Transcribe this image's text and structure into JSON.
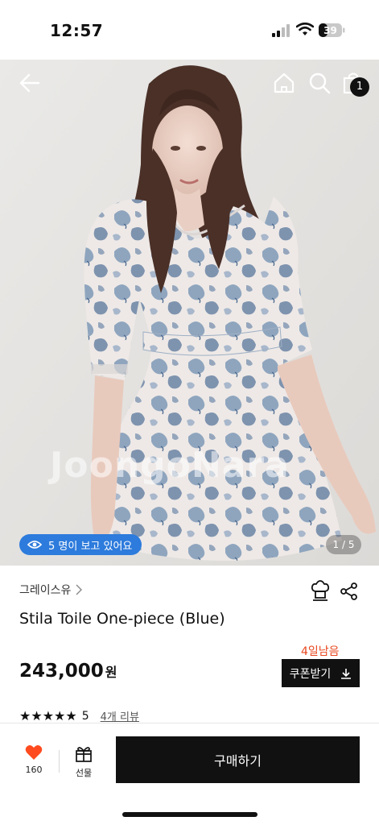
{
  "status_bar": {
    "time": "12:57",
    "battery": "39"
  },
  "hero": {
    "watermark": "JoongoNara",
    "viewers_text": "5 명이 보고 있어요",
    "page_indicator": "1 / 5",
    "cart_count": "1"
  },
  "product": {
    "brand": "그레이스유",
    "title": "Stila Toile One-piece (Blue)",
    "deadline": "4일남음",
    "price": "243,000",
    "price_unit": "원",
    "coupon_label": "쿠폰받기",
    "rating_value": "5",
    "rating_stars": 5,
    "review_link": "4개 리뷰"
  },
  "bottom_bar": {
    "like_count": "160",
    "gift_label": "선물",
    "buy_label": "구매하기"
  },
  "colors": {
    "accent_blue": "#2d7bdc",
    "deadline": "#e8471f",
    "like": "#ff4b1f"
  },
  "icons": [
    "back-arrow-icon",
    "home-icon",
    "search-icon",
    "shopping-bag-icon",
    "eye-icon",
    "chevron-right-icon",
    "chef-hat-icon",
    "share-icon",
    "download-icon",
    "heart-icon",
    "gift-icon"
  ]
}
